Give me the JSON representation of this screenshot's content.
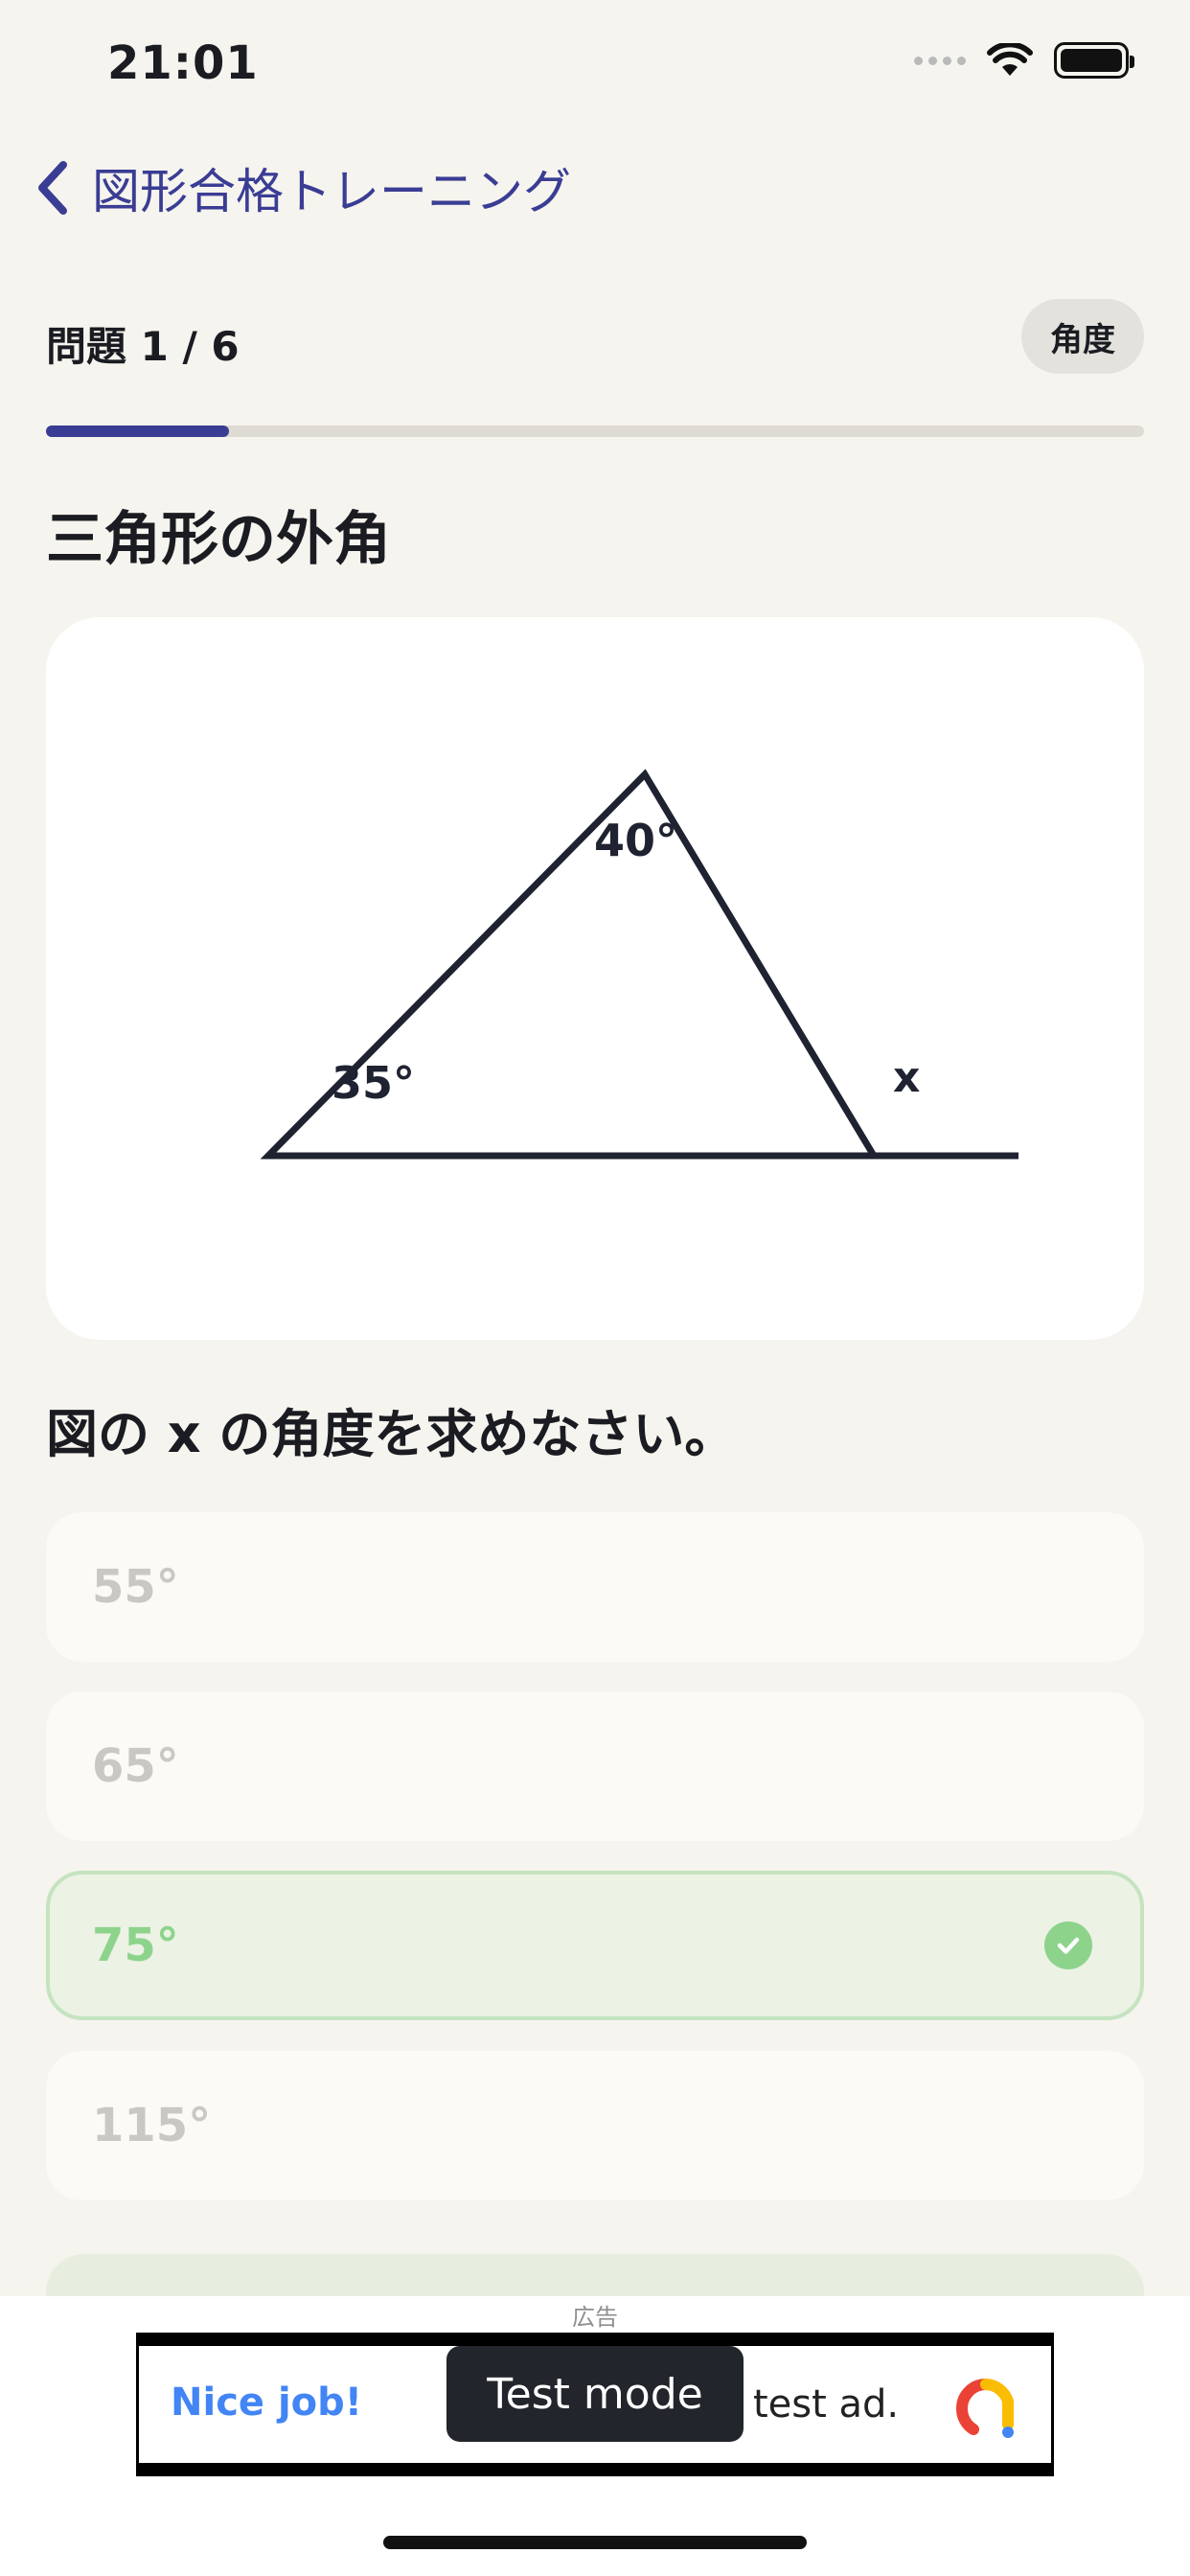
{
  "status_bar": {
    "time": "21:01"
  },
  "nav": {
    "back_title": "図形合格トレーニング"
  },
  "progress": {
    "counter": "問題 1 / 6",
    "topic": "角度",
    "fraction": 0.167
  },
  "question": {
    "heading": "三角形の外角",
    "figure": {
      "top_angle": "40°",
      "left_angle": "35°",
      "exterior_label": "x"
    },
    "prompt": "図の x の角度を求めなさい。"
  },
  "options": [
    {
      "label": "55°",
      "state": "disabled"
    },
    {
      "label": "65°",
      "state": "disabled"
    },
    {
      "label": "75°",
      "state": "correct"
    },
    {
      "label": "115°",
      "state": "disabled"
    }
  ],
  "ad": {
    "label": "広告",
    "headline": "Nice job!",
    "body": "test ad.",
    "toast": "Test mode"
  },
  "colors": {
    "background": "#F6F4EE",
    "accent": "#3a3d94",
    "correct": "#8DD38C",
    "card": "#FFFFFF"
  }
}
